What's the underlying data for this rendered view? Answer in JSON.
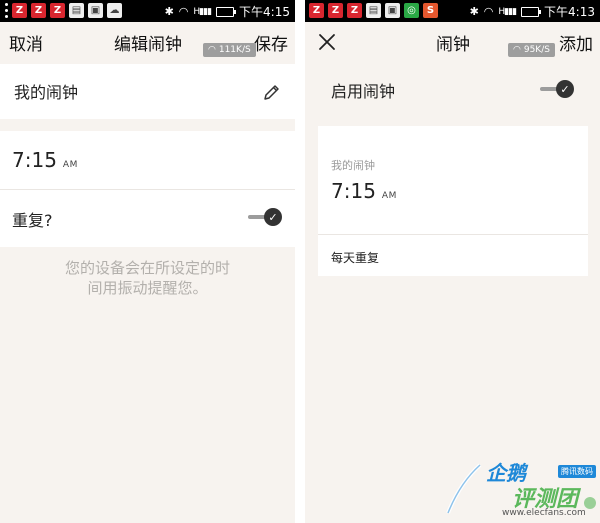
{
  "left": {
    "status_time": "下午4:15",
    "status_battery": "",
    "cancel_label": "取消",
    "title": "编辑闹钟",
    "save_label": "保存",
    "speed": "111K/S",
    "alarm_name": "我的闹钟",
    "alarm_time": "7:15",
    "alarm_ampm": "AM",
    "repeat_label": "重复?",
    "repeat_enabled": true,
    "hint_line1": "您的设备会在所设定的时",
    "hint_line2": "间用振动提醒您。"
  },
  "right": {
    "status_time": "下午4:13",
    "title": "闹钟",
    "add_label": "添加",
    "speed": "95K/S",
    "enable_label": "启用闹钟",
    "enable_on": true,
    "alarm_name": "我的闹钟",
    "alarm_time": "7:15",
    "alarm_ampm": "AM",
    "repeat_text": "每天重复"
  },
  "watermark": {
    "line1": "企鹅",
    "line2": "评测团",
    "badge": "腾讯数码",
    "url": "www.elecfans.com"
  },
  "colors": {
    "background": "#f7f3ef",
    "card": "#ffffff",
    "hint_text": "#b3b0ac",
    "status_bar": "#000000",
    "toggle_thumb": "#333333",
    "toggle_track": "#9c9c9c",
    "watermark_blue": "#1e88d8",
    "watermark_green": "#5cb85c"
  },
  "icons": {
    "left_status": [
      "notification-z-icon",
      "notification-z-icon",
      "notification-z-icon",
      "box-icon",
      "image-icon",
      "wechat-icon"
    ],
    "right_status": [
      "notification-z-icon",
      "notification-z-icon",
      "notification-z-icon",
      "box-icon",
      "image-icon",
      "wechat-icon",
      "sogou-icon"
    ],
    "edit": "pencil-icon",
    "close": "close-icon",
    "toggle": "check-toggle-icon"
  }
}
